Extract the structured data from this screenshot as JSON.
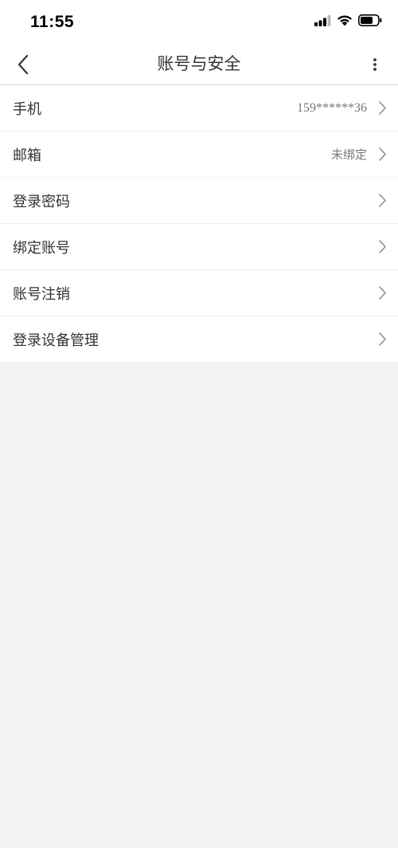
{
  "status_bar": {
    "time": "11:55"
  },
  "nav": {
    "title": "账号与安全"
  },
  "menu": [
    {
      "label": "手机",
      "value": "159******36"
    },
    {
      "label": "邮箱",
      "value": "未绑定"
    },
    {
      "label": "登录密码",
      "value": ""
    },
    {
      "label": "绑定账号",
      "value": ""
    },
    {
      "label": "账号注销",
      "value": ""
    },
    {
      "label": "登录设备管理",
      "value": ""
    }
  ]
}
